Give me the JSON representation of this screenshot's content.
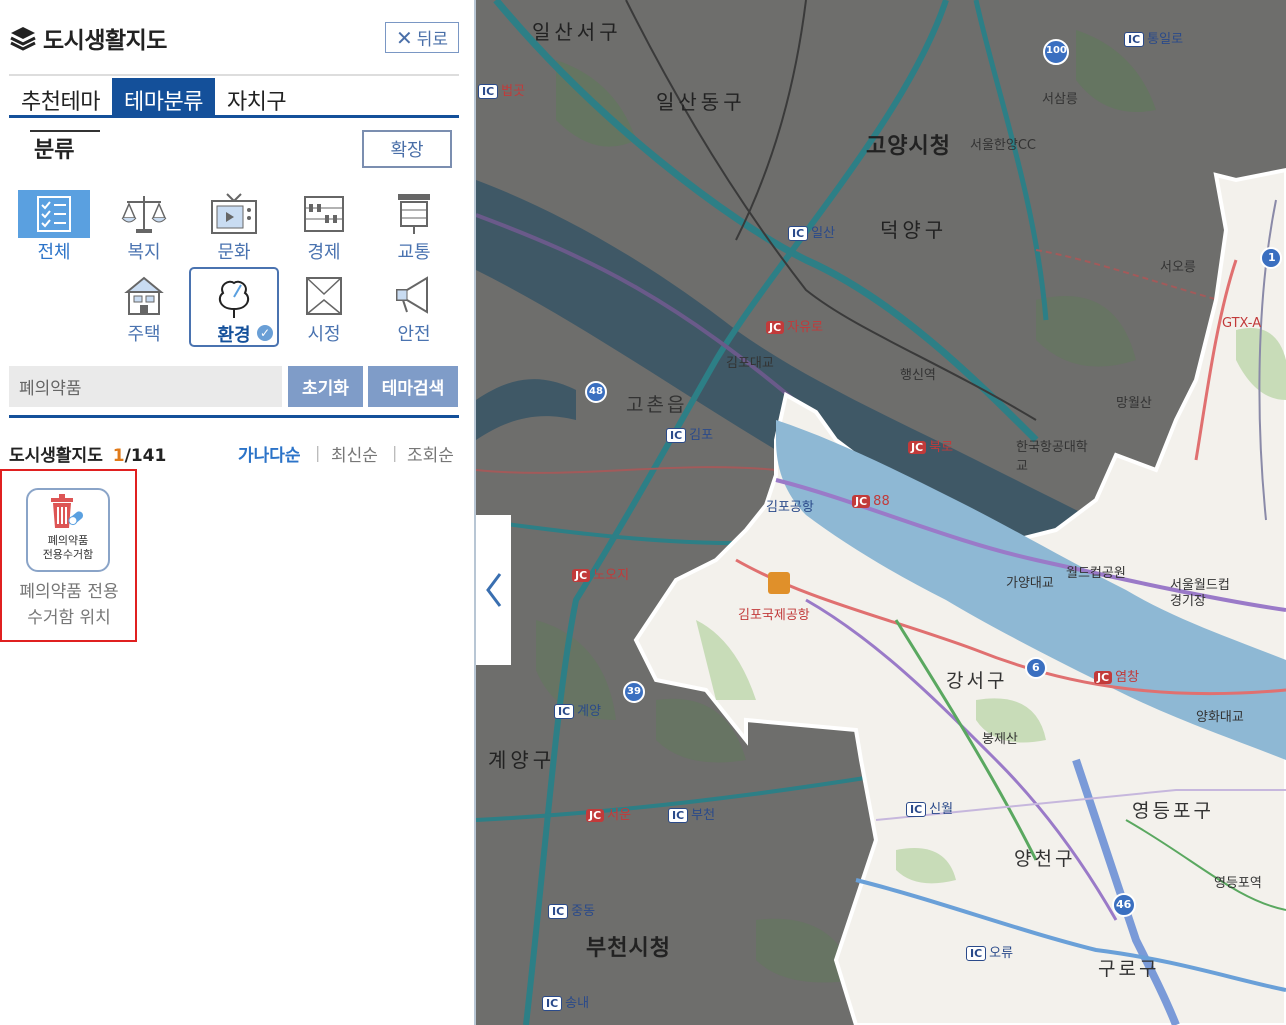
{
  "panel": {
    "title": "도시생활지도",
    "back_label": "뒤로",
    "tabs": [
      "추천테마",
      "테마분류",
      "자치구"
    ],
    "section_title": "분류",
    "expand_label": "확장",
    "categories": [
      "전체",
      "복지",
      "문화",
      "경제",
      "교통",
      "주택",
      "환경",
      "시정",
      "안전"
    ],
    "search": {
      "value": "폐의약품"
    },
    "reset_label": "초기화",
    "theme_search_label": "테마검색",
    "list": {
      "title": "도시생활지도",
      "count_current": "1",
      "count_total": "/141",
      "sort_options": [
        "가나다순",
        "최신순",
        "조회순"
      ]
    },
    "result": {
      "icon_text_line1": "폐의약품",
      "icon_text_line2": "전용수거함",
      "label_line1": "폐의약품 전용",
      "label_line2": "수거함 위치"
    }
  },
  "map": {
    "labels": {
      "ilsanseo": "일산서구",
      "ilsandong": "일산동구",
      "goyang": "고양시청",
      "deogyang": "덕양구",
      "gangseo": "강서구",
      "gyeyang": "계양구",
      "bucheon": "부천시청",
      "yangcheon": "양천구",
      "yeongdeungpo": "영등포구",
      "guro": "구로구",
      "gimpo_airport_intl": "김포국제공항",
      "gimpo_airport": "김포공항",
      "haengsin": "행신역",
      "mangwolsan": "망월산",
      "bongjesan": "봉제산",
      "worldcup_park": "월드컵공원",
      "seoul_worldcup": "서울월드컵",
      "stadium": "경기장",
      "gayang_bridge": "가양대교",
      "yanghwa_bridge": "양화대교",
      "seoreung": "서오릉",
      "seosamneung": "서삼릉",
      "gimpo_bridge": "김포대교",
      "yeongdeungpo_station": "영등포역",
      "korea_aero_univ": "한국항공대학교",
      "seoul_hanyang_cc": "서울한양CC",
      "ic_ilsan": "일산",
      "ic_gimpo": "김포",
      "ic_gyeyang": "계양",
      "ic_bucheon": "부천",
      "ic_sinwol": "신월",
      "ic_jungdong": "중동",
      "ic_songnae": "송내",
      "ic_oryu": "오류",
      "ic_tongil": "통일로",
      "ic_beopgot": "법곳",
      "jc_jayuro": "자유로",
      "jc_bukro": "북로",
      "jc_88": "88",
      "jc_nowoji": "노오지",
      "jc_seoun": "서운",
      "jc_yeomchang": "염창",
      "gochon": "고촌읍",
      "gtx": "GTX-A",
      "route_100": "100",
      "route_48": "48",
      "route_39": "39",
      "route_6": "6",
      "route_46": "46",
      "route_1": "1"
    }
  }
}
